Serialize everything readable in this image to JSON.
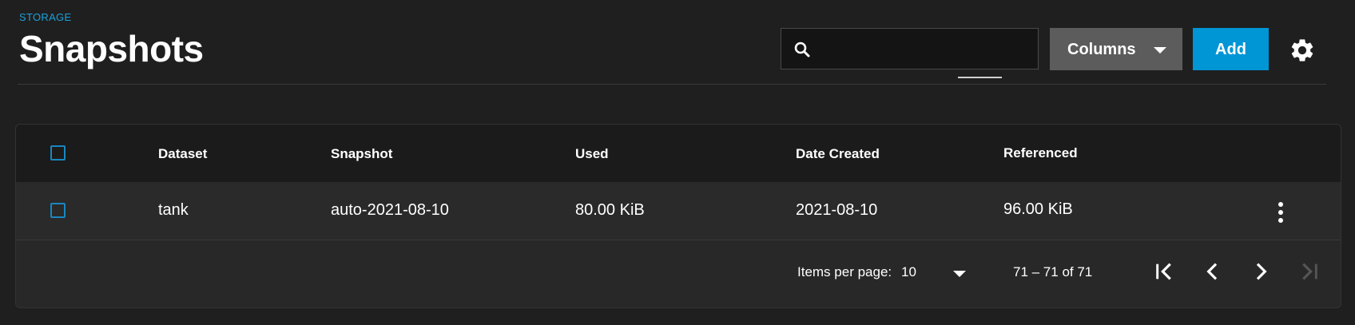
{
  "header": {
    "breadcrumb": "STORAGE",
    "title": "Snapshots"
  },
  "toolbar": {
    "search_placeholder": "",
    "search_value": "",
    "columns_label": "Columns",
    "add_label": "Add",
    "settings_icon": "gear-icon"
  },
  "table": {
    "columns": [
      "Dataset",
      "Snapshot",
      "Used",
      "Date Created",
      "Referenced"
    ],
    "rows": [
      {
        "dataset": "tank",
        "snapshot": "auto-2021-08-10",
        "used": "80.00 KiB",
        "date_created": "2021-08-10",
        "referenced": "96.00 KiB"
      }
    ]
  },
  "paginator": {
    "items_per_page_label": "Items per page:",
    "page_size": "10",
    "range_label": "71 – 71 of 71",
    "icons": [
      "first-page-icon",
      "previous-page-icon",
      "next-page-icon",
      "last-page-icon"
    ]
  },
  "colors": {
    "accent": "#0095d5",
    "breadcrumb": "#1aa0db",
    "background": "#1f1f1f",
    "card": "#282828",
    "checkbox_border": "#1a86c0",
    "columns_button": "#5c5c5c"
  }
}
